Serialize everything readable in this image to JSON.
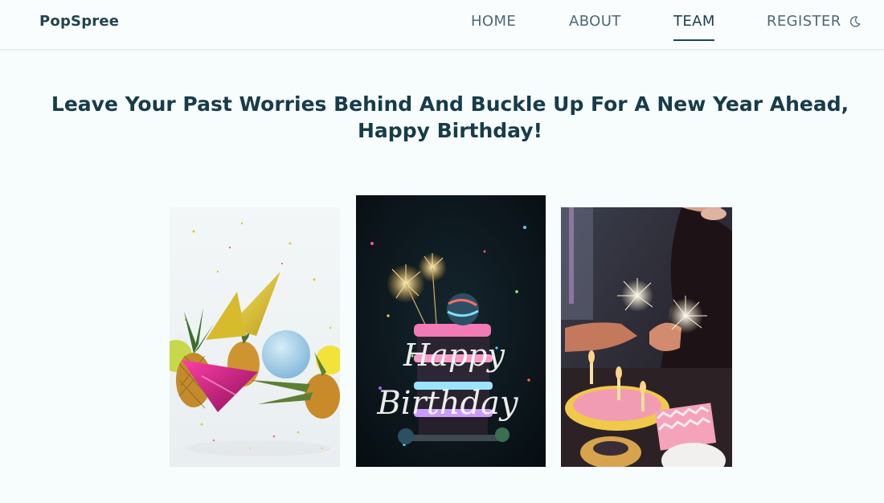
{
  "nav": {
    "brand": "PopSpree",
    "links": [
      {
        "label": "HOME",
        "active": false
      },
      {
        "label": "ABOUT",
        "active": false
      },
      {
        "label": "TEAM",
        "active": true
      },
      {
        "label": "REGISTER",
        "active": false
      }
    ],
    "theme_toggle_icon": "moon-icon"
  },
  "hero": {
    "headline_line1": "Leave Your Past Worries Behind And Buckle Up For A New Year Ahead,",
    "headline_line2": "Happy Birthday!"
  },
  "gallery": {
    "photos": [
      {
        "subject": "party-hats-pineapples"
      },
      {
        "subject": "birthday-cake-sparklers",
        "overlay_line1": "Happy",
        "overlay_line2": "Birthday"
      },
      {
        "subject": "friends-sparklers-cake"
      }
    ]
  },
  "colors": {
    "background": "#f7fcfd",
    "heading": "#173c49",
    "nav_text": "#4e6874",
    "accent_underline": "#1f4550"
  }
}
